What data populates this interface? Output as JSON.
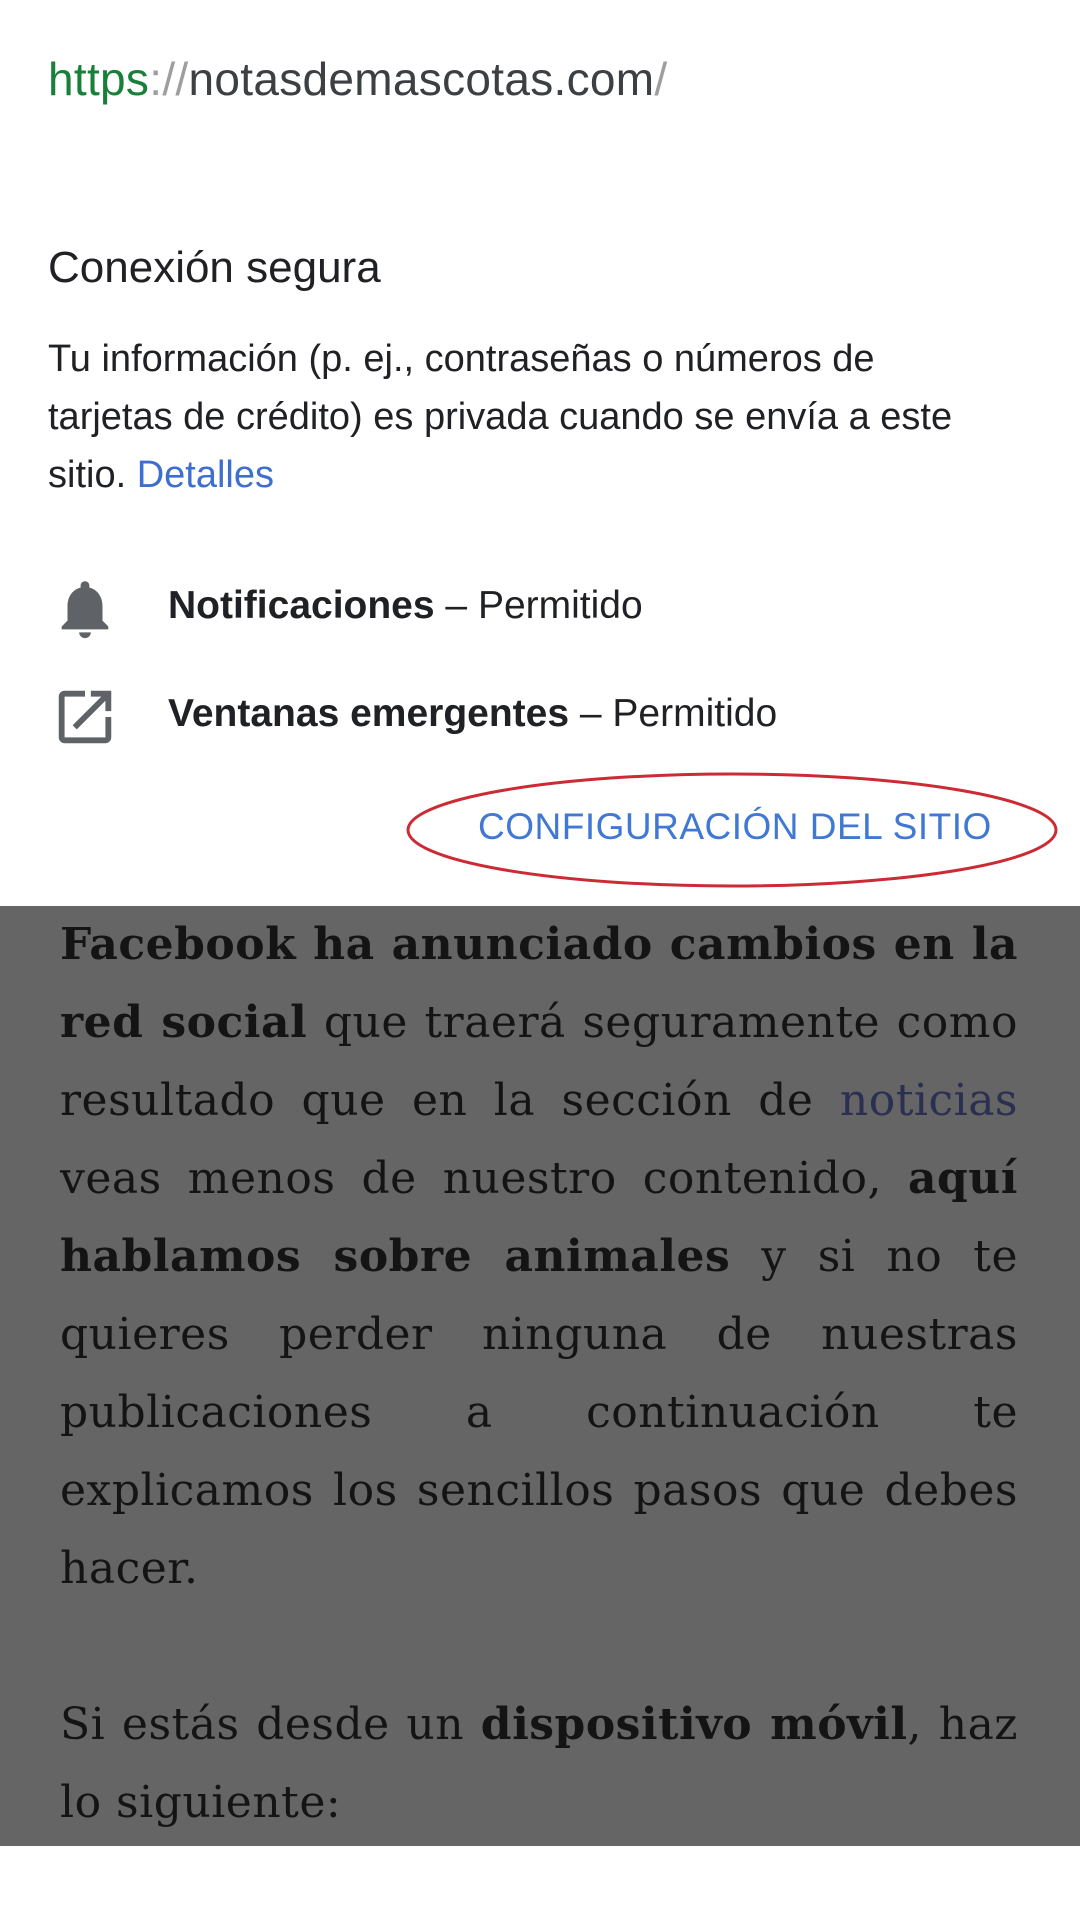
{
  "site_info": {
    "url": {
      "scheme": "https",
      "separator": "://",
      "host": "notasdemascotas.com",
      "trailing": "/"
    },
    "security": {
      "title": "Conexión segura",
      "description": "Tu información (p. ej., contraseñas o números de tarjetas de crédito) es privada cuando se envía a este sitio.",
      "details_link": "Detalles"
    },
    "permissions": [
      {
        "icon": "bell-icon",
        "name": "Notificaciones",
        "separator": " – ",
        "status": "Permitido"
      },
      {
        "icon": "open-in-new-icon",
        "name": "Ventanas emergentes",
        "separator": " – ",
        "status": "Permitido"
      }
    ],
    "site_settings_button": "CONFIGURACIÓN DEL SITIO",
    "annotation_color": "#cc2b35"
  },
  "article": {
    "p1": {
      "b1": "Facebook ha anunciado cambios en la red social",
      "t1": " que traerá seguramente como resultado que en la sección de ",
      "link": "noticias",
      "t2": " veas menos de nuestro contenido, ",
      "b2": "aquí hablamos sobre animales",
      "t3": " y si no te quieres perder ninguna de nuestras publicaciones a continuación te explicamos los sencillos pasos que debes hacer."
    },
    "p2": {
      "t1": "Si estás desde un ",
      "b1": "dispositivo móvil",
      "t2": ", haz lo siguiente:"
    }
  },
  "colors": {
    "https_green": "#188038",
    "link_blue": "#3f6fce",
    "button_blue": "#4078d4",
    "overlay_gray": "#656565"
  }
}
